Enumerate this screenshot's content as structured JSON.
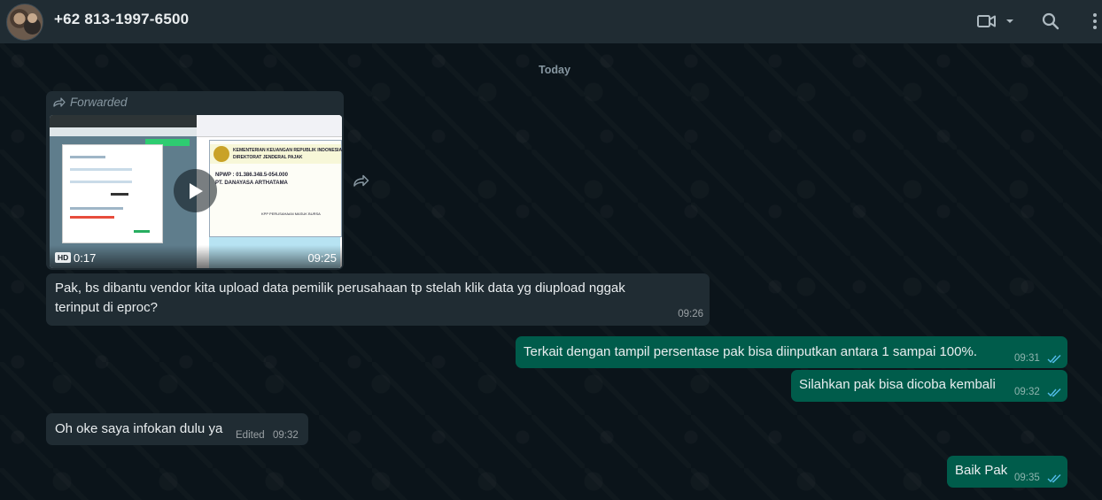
{
  "header": {
    "contact_name": "+62 813-1997-6500",
    "icons": [
      "video-call-icon",
      "chevron-down-icon",
      "search-icon",
      "menu-dots-icon"
    ]
  },
  "chat": {
    "date_divider": "Today",
    "messages": [
      {
        "direction": "incoming",
        "forwarded_label": "Forwarded",
        "video": {
          "quality_badge": "HD",
          "duration": "0:17",
          "time": "09:25"
        }
      },
      {
        "direction": "incoming",
        "text_line1": "Pak, bs dibantu vendor kita upload data pemilik perusahaan tp stelah klik data yg diupload nggak",
        "text_line2": "terinput di eproc?",
        "time": "09:26"
      },
      {
        "direction": "outgoing",
        "text": "Terkait dengan tampil persentase pak bisa diinputkan antara 1 sampai 100%.",
        "time": "09:31",
        "status": "read"
      },
      {
        "direction": "outgoing",
        "text": "Silahkan pak bisa dicoba kembali",
        "time": "09:32",
        "status": "read"
      },
      {
        "direction": "incoming",
        "text": "Oh oke saya infokan dulu ya",
        "edited_label": "Edited",
        "time": "09:32"
      },
      {
        "direction": "outgoing",
        "text": "Baik Pak",
        "time": "09:35",
        "status": "read"
      }
    ]
  },
  "colors": {
    "header_bg": "#202c33",
    "chat_bg": "#0b141a",
    "incoming_bubble": "#202c33",
    "outgoing_bubble": "#005c4b",
    "read_tick": "#53bdeb",
    "muted_text": "#8696a0"
  }
}
